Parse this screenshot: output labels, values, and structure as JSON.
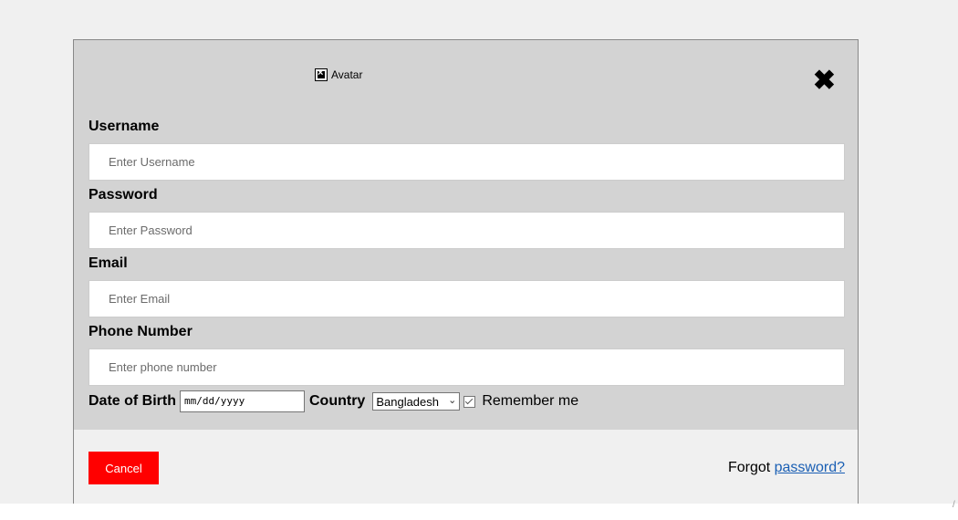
{
  "modal": {
    "avatar_alt": "Avatar",
    "close_symbol": "✖",
    "fields": {
      "username": {
        "label": "Username",
        "placeholder": "Enter Username"
      },
      "password": {
        "label": "Password",
        "placeholder": "Enter Password"
      },
      "email": {
        "label": "Email",
        "placeholder": "Enter Email"
      },
      "phone": {
        "label": "Phone Number",
        "placeholder": "Enter phone number"
      }
    },
    "dob": {
      "label": "Date of Birth",
      "placeholder": "mm/dd/yyyy"
    },
    "country": {
      "label": "Country",
      "selected": "Bangladesh"
    },
    "remember": {
      "label": "Remember me",
      "checked": true
    },
    "footer": {
      "cancel_label": "Cancel",
      "forgot_prefix": "Forgot ",
      "forgot_link": "password?"
    }
  },
  "colors": {
    "modal_body_bg": "#d3d3d3",
    "page_bg": "#f0f0f0",
    "cancel_bg": "#ff0000",
    "link": "#1a5fb4"
  }
}
